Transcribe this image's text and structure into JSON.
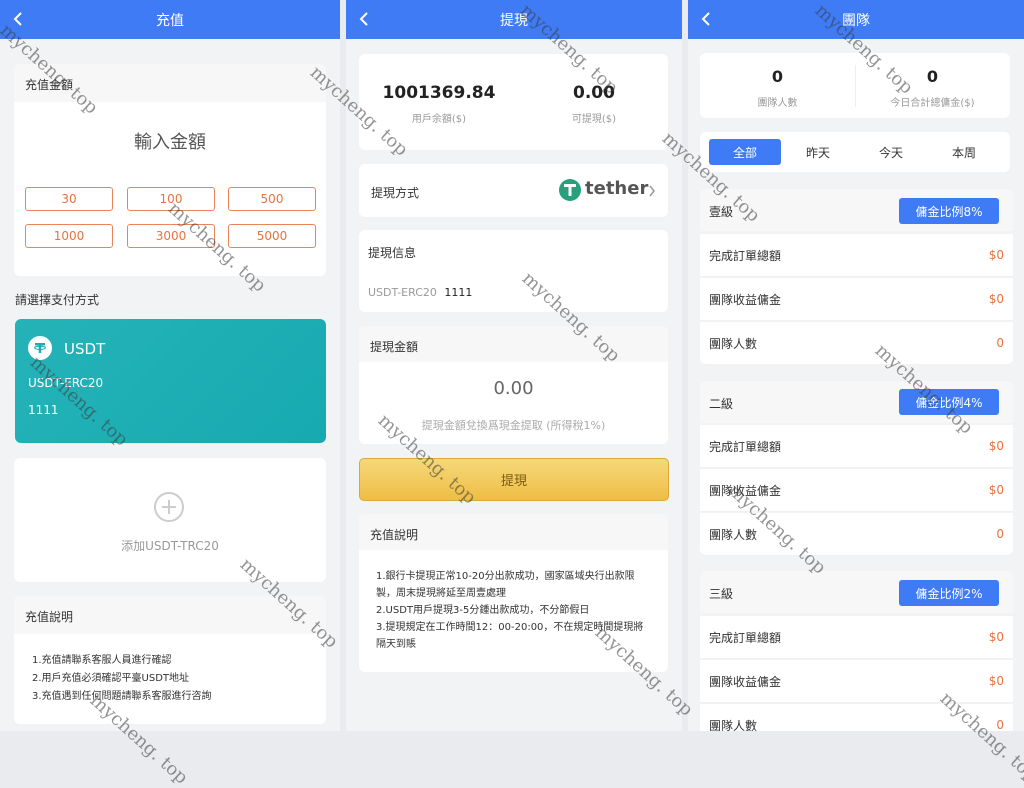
{
  "recharge": {
    "title": "充值",
    "amount_section_title": "充值金額",
    "amount_placeholder": "輸入金額",
    "amounts": [
      "30",
      "100",
      "500",
      "1000",
      "3000",
      "5000"
    ],
    "payment_method_title": "請選擇支付方式",
    "card": {
      "name": "USDT",
      "network": "USDT-ERC20",
      "address": "1111",
      "card_color": "#1aaeb3"
    },
    "add_label": "添加USDT-TRC20",
    "notes_title": "充值說明",
    "notes": [
      "1.充值請聯系客服人員進行確認",
      "2.用戶充值必須確認平臺USDT地址",
      "3.充值遇到任何問題請聯系客服進行咨詢"
    ]
  },
  "withdraw": {
    "title": "提現",
    "balance": {
      "value": "1001369.84",
      "label": "用戶余額($)"
    },
    "withdrawable": {
      "value": "0.00",
      "label": "可提現($)"
    },
    "method_label": "提現方式",
    "method_value": "tether",
    "info_title": "提現信息",
    "info_network": "USDT-ERC20",
    "info_address": "1111",
    "amount_title": "提現金額",
    "amount_value": "0.00",
    "amount_hint": "提現金額兌換爲現金提取 (所得稅1%)",
    "submit_label": "提現",
    "notes_title": "充值說明",
    "notes": [
      "1.銀行卡提現正常10-20分出款成功，國家區域央行出款限製，周末提現將延至周壹處理",
      "2.USDT用戶提現3-5分鍾出款成功，不分節假日",
      "3.提現規定在工作時間12：00-20:00，不在規定時間提現將隔天到賬"
    ],
    "button_color": "#eebe45",
    "tether_color": "#26a17b"
  },
  "team": {
    "title": "團隊",
    "stats": [
      {
        "value": "0",
        "label": "團隊人數"
      },
      {
        "value": "0",
        "label": "今日合計總傭金($)"
      }
    ],
    "tabs": [
      {
        "label": "全部",
        "active": true
      },
      {
        "label": "昨天",
        "active": false
      },
      {
        "label": "今天",
        "active": false
      },
      {
        "label": "本周",
        "active": false
      }
    ],
    "levels": [
      {
        "name": "壹級",
        "rate": "傭金比例8%",
        "rows": [
          {
            "label": "完成訂單總額",
            "value": "$0"
          },
          {
            "label": "團隊收益傭金",
            "value": "$0"
          },
          {
            "label": "團隊人數",
            "value": "0"
          }
        ]
      },
      {
        "name": "二級",
        "rate": "傭金比例4%",
        "rows": [
          {
            "label": "完成訂單總額",
            "value": "$0"
          },
          {
            "label": "團隊收益傭金",
            "value": "$0"
          },
          {
            "label": "團隊人數",
            "value": "0"
          }
        ]
      },
      {
        "name": "三級",
        "rate": "傭金比例2%",
        "rows": [
          {
            "label": "完成訂單總額",
            "value": "$0"
          },
          {
            "label": "團隊收益傭金",
            "value": "$0"
          },
          {
            "label": "團隊人數",
            "value": "0"
          }
        ]
      }
    ],
    "accent_color": "#3e7bf5",
    "value_color": "#e8733f"
  },
  "watermark": "mycheng. top"
}
